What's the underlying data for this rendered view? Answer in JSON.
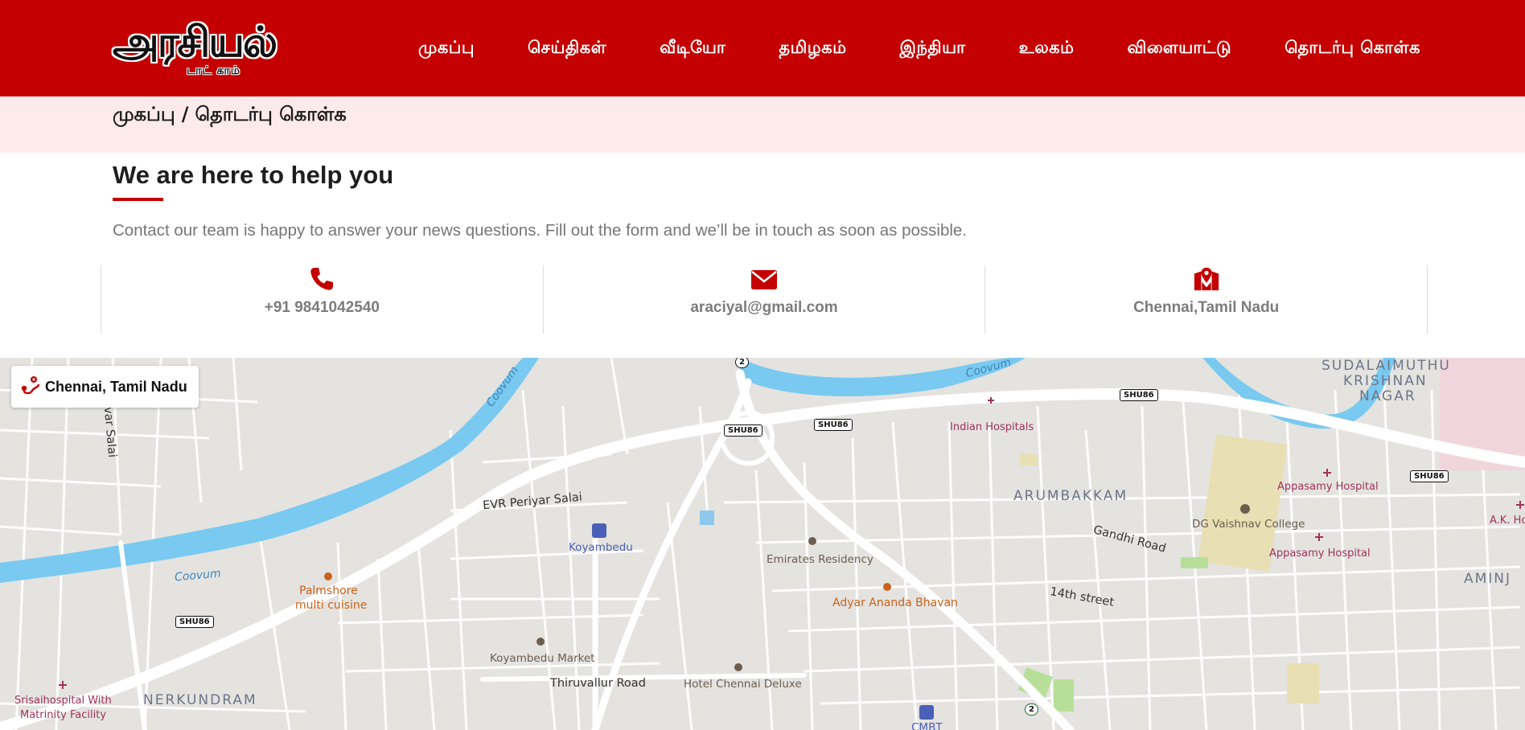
{
  "header": {
    "logo_main": "அரசியல்",
    "logo_sub": "டாட் காம்",
    "brand_color": "#c40000",
    "nav": [
      {
        "label": "முகப்பு"
      },
      {
        "label": "செய்திகள்"
      },
      {
        "label": "வீடியோ"
      },
      {
        "label": "தமிழகம்"
      },
      {
        "label": "இந்தியா"
      },
      {
        "label": "உலகம்"
      },
      {
        "label": "விளையாட்டு"
      },
      {
        "label": "தொடர்பு கொள்க"
      }
    ]
  },
  "breadcrumb": {
    "home": "முகப்பு",
    "separator": "/",
    "current": "தொடர்பு கொள்க"
  },
  "contact": {
    "heading": "We are here to help you",
    "intro": "Contact our team is happy to answer your news questions. Fill out the form and we’ll be in touch as soon as possible.",
    "cards": [
      {
        "icon": "phone-icon",
        "text": "+91 9841042540"
      },
      {
        "icon": "envelope-icon",
        "text": "araciyal@gmail.com"
      },
      {
        "icon": "map-marker-icon",
        "text": "Chennai,Tamil Nadu"
      }
    ]
  },
  "map": {
    "location_badge": "Chennai, Tamil Nadu",
    "labels": {
      "sudalaimuthu": "SUDALAIMUTHU",
      "krishnan": "KRISHNAN",
      "nagar": "NAGAR",
      "indian_hospitals": "Indian Hospitals",
      "appasamy_1": "Appasamy Hospital",
      "appasamy_2": "Appasamy Hospital",
      "ak_hospital": "A.K. Ho",
      "arumbakkam": "ARUMBAKKAM",
      "dg_vaishnav": "DG Vaishnav College",
      "gandhi_road": "Gandhi Road",
      "aminji": "AMINJ",
      "evr_salai": "EVR Periyar Salai",
      "koyambedu": "Koyambedu",
      "emirates": "Emirates Residency",
      "adyar": "Adyar Ananda Bhavan",
      "fourteenth": "14th street",
      "palmshore_1": "Palmshore",
      "palmshore_2": "multi cuisine",
      "koyambedu_market": "Koyambedu Market",
      "thiruvallur": "Thiruvallur Road",
      "hotel_chennai": "Hotel Chennai Deluxe",
      "srisai_1": "Srisaihospital With",
      "srisai_2": "Matrinity Facility",
      "nerkundram": "NERKUNDRAM",
      "cmbt": "CMBT",
      "uvar_salai": "uvar Salai",
      "coovum_1": "Coovum",
      "coovum_2": "Coovum",
      "coovum_3": "Coovum"
    },
    "shields": {
      "shu86_a": "SHU86",
      "shu86_b": "SHU86",
      "shu86_c": "SHU86",
      "shu86_d": "SHU86",
      "shu86_e": "SHU86",
      "nh2_top": "2",
      "nh2_bottom": "2"
    }
  }
}
